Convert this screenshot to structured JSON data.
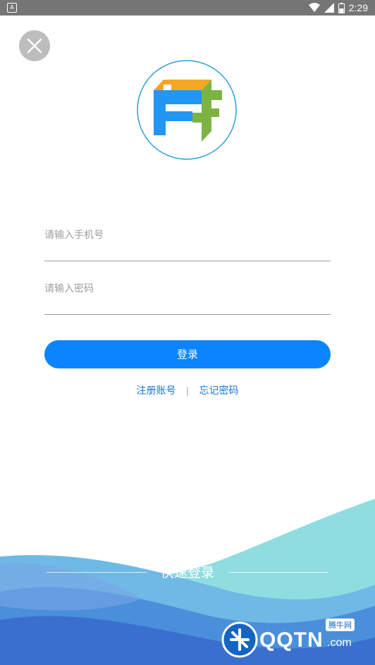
{
  "status_bar": {
    "time": "2:29"
  },
  "login": {
    "phone_placeholder": "请输入手机号",
    "password_placeholder": "请输入密码",
    "login_button": "登录",
    "register_link": "注册账号",
    "divider": "|",
    "forgot_link": "忘记密码",
    "quick_login": "快速登录"
  },
  "watermark": {
    "brand": "QQTN",
    "suffix": ".com",
    "tag": "腾牛网"
  },
  "colors": {
    "accent": "#0a84ff",
    "link": "#1976d2",
    "logo_orange": "#f5a623",
    "logo_blue": "#2196f3",
    "logo_green": "#7cb342"
  }
}
